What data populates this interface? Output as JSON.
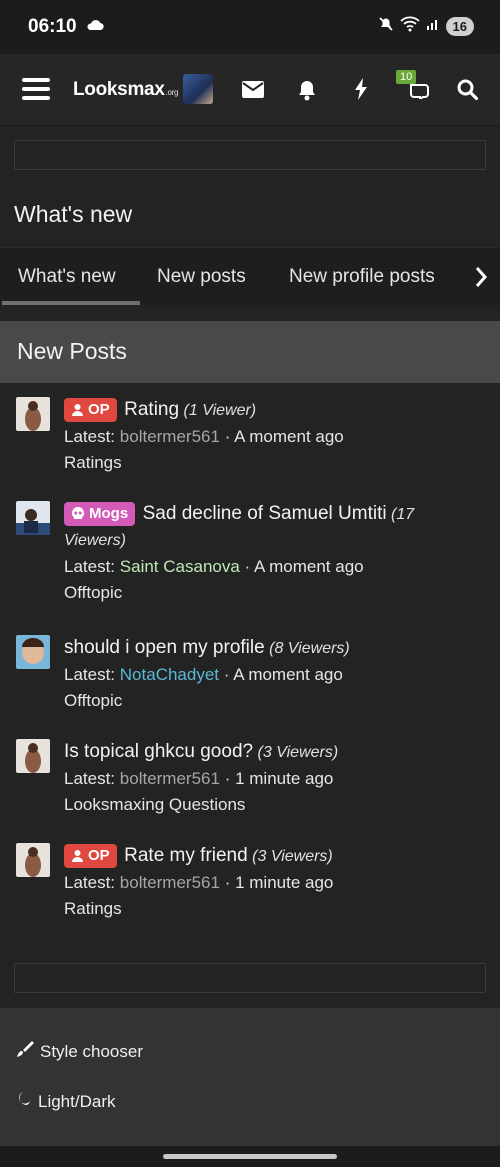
{
  "status_bar": {
    "time": "06:10",
    "battery": "16"
  },
  "nav": {
    "logo": "Looksmax",
    "logo_suffix": ".org",
    "conversations_badge": "10"
  },
  "page": {
    "title": "What's new"
  },
  "tabs": [
    {
      "label": "What's new"
    },
    {
      "label": "New posts"
    },
    {
      "label": "New profile posts"
    }
  ],
  "section": {
    "heading": "New Posts"
  },
  "posts": [
    {
      "prefix": "OP",
      "title": "Rating",
      "viewers": "(1 Viewer)",
      "latest_label": "Latest:",
      "user": "boltermer561",
      "time": "· A moment ago",
      "forum": "Ratings"
    },
    {
      "prefix": "Mogs",
      "title": "Sad decline of Samuel Umtiti",
      "viewers": "(17 Viewers)",
      "latest_label": "Latest:",
      "user": "Saint Casanova",
      "time": "· A moment ago",
      "forum": "Offtopic"
    },
    {
      "prefix": "",
      "title": "should i open my profile",
      "viewers": "(8 Viewers)",
      "latest_label": "Latest:",
      "user": "NotaChadyet",
      "time": "· A moment ago",
      "forum": "Offtopic"
    },
    {
      "prefix": "",
      "title": "Is topical ghkcu good?",
      "viewers": "(3 Viewers)",
      "latest_label": "Latest:",
      "user": "boltermer561",
      "time": "· 1 minute ago",
      "forum": "Looksmaxing Questions"
    },
    {
      "prefix": "OP",
      "title": "Rate my friend",
      "viewers": "(3 Viewers)",
      "latest_label": "Latest:",
      "user": "boltermer561",
      "time": "· 1 minute ago",
      "forum": "Ratings"
    }
  ],
  "footer": {
    "style_chooser": "Style chooser",
    "light_dark": "Light/Dark"
  },
  "colors": {
    "op_badge": "#e0473f",
    "mogs_badge": "#d45ab8",
    "username_green": "#bfe8b4",
    "username_blue": "#58b9d6",
    "alerts_badge": "#6aa83a"
  }
}
